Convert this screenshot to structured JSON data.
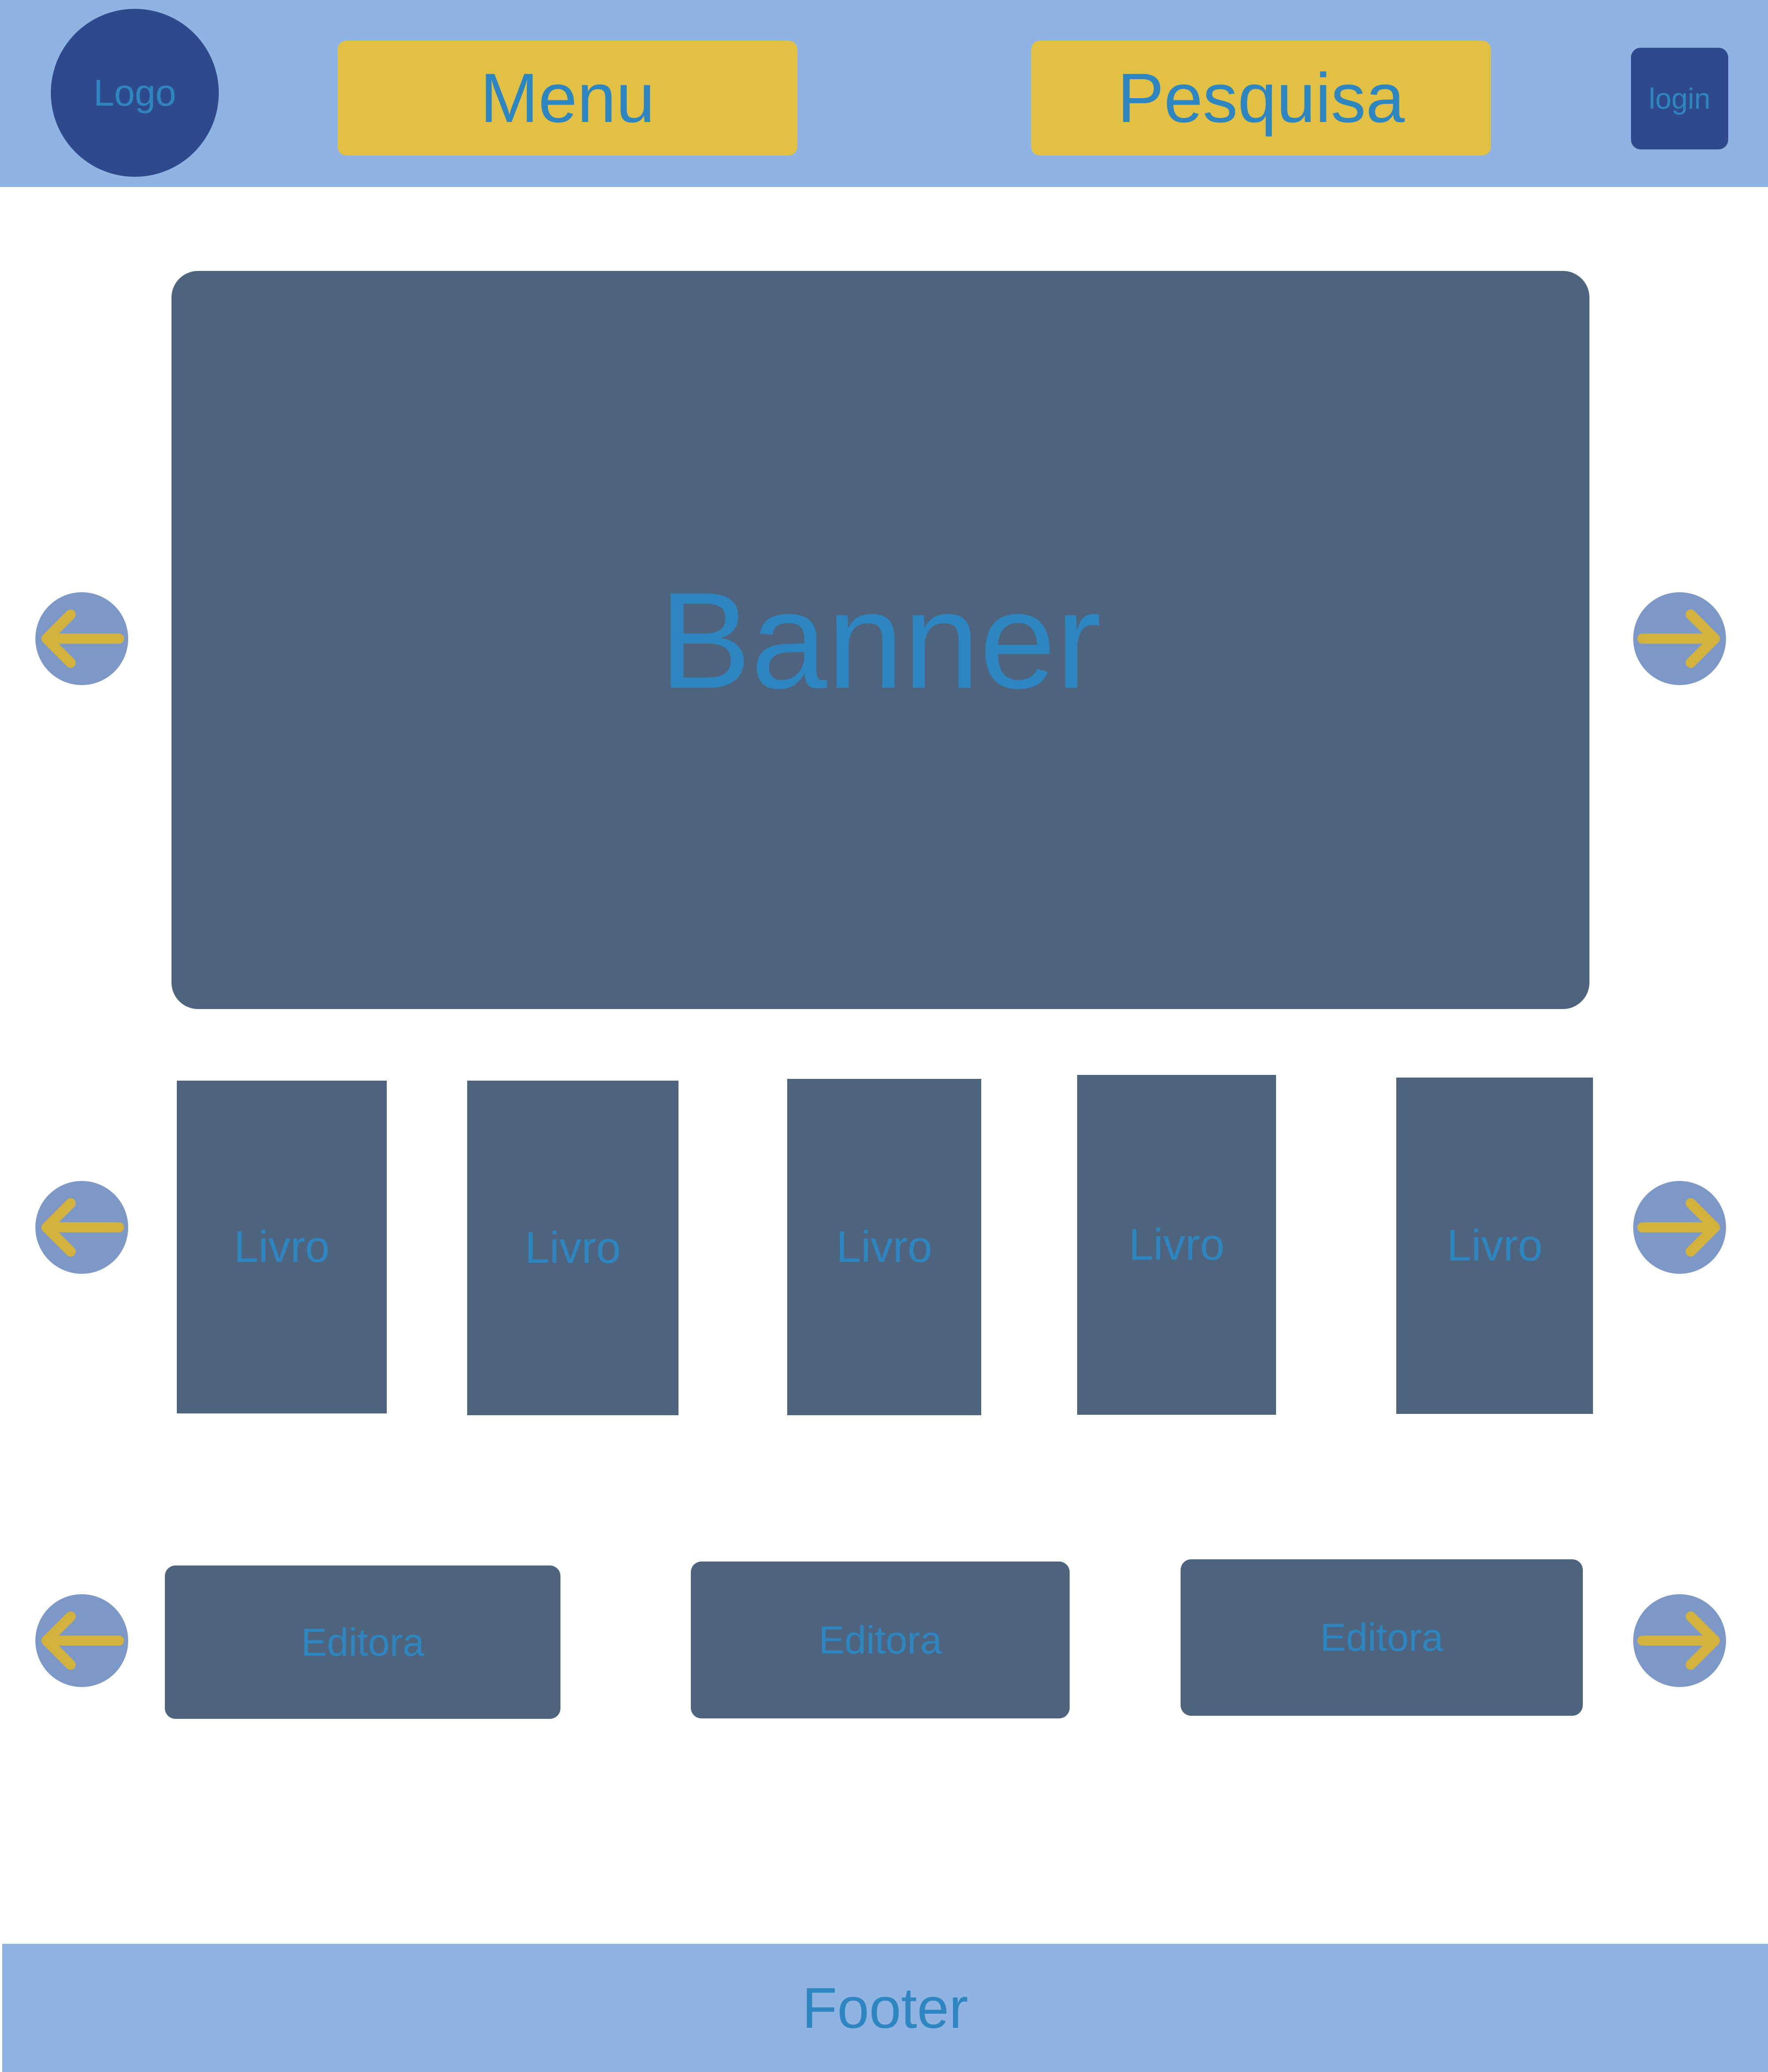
{
  "header": {
    "logo": "Logo",
    "menu": "Menu",
    "search": "Pesquisa",
    "login": "login"
  },
  "banner": {
    "label": "Banner"
  },
  "books": [
    "Livro",
    "Livro",
    "Livro",
    "Livro",
    "Livro"
  ],
  "publishers": [
    "Editora",
    "Editora",
    "Editora"
  ],
  "footer": {
    "label": "Footer"
  },
  "colors": {
    "header_bg": "#8fb4e3",
    "accent_yellow": "#e2c044",
    "dark_blue": "#2f4a8c",
    "block_slate": "#4e637d",
    "text_blue": "#2e86c1",
    "arrow_circle": "#7c98c6",
    "arrow_yellow": "#d4b23e"
  },
  "icons": {
    "prev": "arrow-left-icon",
    "next": "arrow-right-icon"
  }
}
